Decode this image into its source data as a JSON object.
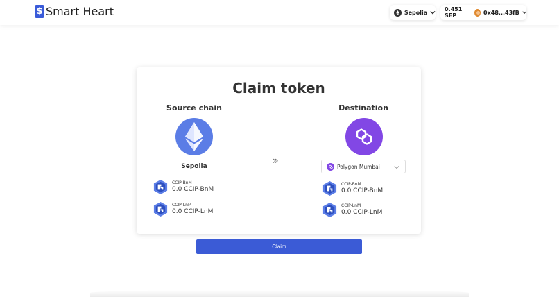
{
  "header": {
    "logo_mark": "$",
    "app_name": "Smart Heart",
    "network": "Sepolia",
    "balance": "0.451 SEP",
    "account": "0x48...43fB"
  },
  "card": {
    "title": "Claim token",
    "source": {
      "heading": "Source chain",
      "chain_name": "Sepolia",
      "icon": "ethereum-icon",
      "tokens": [
        {
          "name": "CCIP-BnM",
          "amount": "0.0 CCIP-BnM"
        },
        {
          "name": "CCIP-LnM",
          "amount": "0.0 CCIP-LnM"
        }
      ]
    },
    "arrow": "»",
    "destination": {
      "heading": "Destination",
      "icon": "polygon-icon",
      "selected_chain": "Polygon Mumbai",
      "tokens": [
        {
          "name": "CCIP-BnM",
          "amount": "0.0 CCIP-BnM"
        },
        {
          "name": "CCIP-LnM",
          "amount": "0.0 CCIP-LnM"
        }
      ]
    }
  },
  "claim_button": "Claim",
  "colors": {
    "brand": "#3a5bd9",
    "ethereum": "#5b7de6",
    "polygon": "#8247e5",
    "button": "#3b5bd6"
  }
}
